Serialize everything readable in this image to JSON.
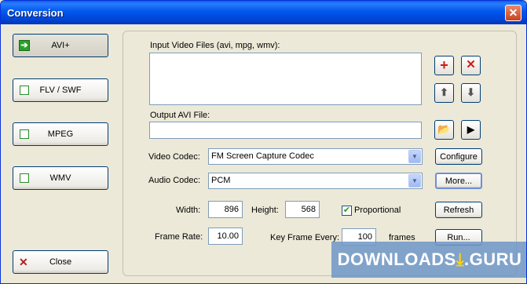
{
  "window": {
    "title": "Conversion",
    "close_glyph": "✕"
  },
  "sidebar": {
    "items": [
      {
        "label": "AVI+",
        "state": "active",
        "icon": "arrow-icon"
      },
      {
        "label": "FLV / SWF"
      },
      {
        "label": "MPEG"
      },
      {
        "label": "WMV"
      }
    ],
    "close_label": "Close"
  },
  "input": {
    "label": "Input Video Files (avi, mpg, wmv):",
    "value": ""
  },
  "output": {
    "label": "Output AVI File:",
    "value": ""
  },
  "video_codec": {
    "label": "Video Codec:",
    "value": "FM Screen Capture Codec",
    "button": "Configure"
  },
  "audio_codec": {
    "label": "Audio Codec:",
    "value": "PCM",
    "button": "More..."
  },
  "width": {
    "label": "Width:",
    "value": "896"
  },
  "height": {
    "label": "Height:",
    "value": "568"
  },
  "proportional": {
    "label": "Proportional",
    "checked": true
  },
  "refresh_label": "Refresh",
  "frame_rate": {
    "label": "Frame Rate:",
    "value": "10.00"
  },
  "key_frame": {
    "label": "Key Frame Every:",
    "value": "100",
    "unit": "frames"
  },
  "run_label": "Run...",
  "watermark": {
    "prefix": "DOWNLOADS",
    "suffix": ".GURU"
  },
  "colors": {
    "titlebar": "#0058ee",
    "face": "#ece9d8",
    "add": "#cc1b1b",
    "check": "#21a121"
  }
}
